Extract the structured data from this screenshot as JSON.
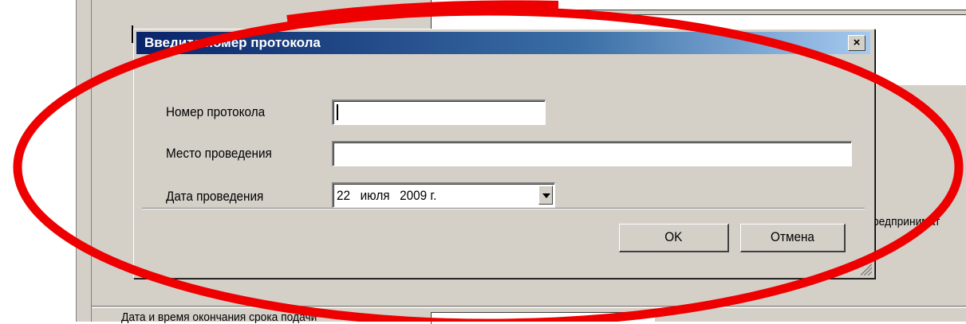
{
  "background": {
    "bottom_label": "Дата и время окончания срока подачи",
    "side_text": "редпринимат"
  },
  "dialog": {
    "title": "Введите номер протокола",
    "close_label": "×",
    "fields": {
      "protocol_number_label": "Номер протокола",
      "protocol_number_value": "",
      "venue_label": "Место проведения",
      "venue_value": "",
      "date_label": "Дата проведения",
      "date_day": "22",
      "date_month": "июля",
      "date_year": "2009 г."
    },
    "buttons": {
      "ok": "OK",
      "cancel": "Отмена"
    }
  },
  "annotation": {
    "color": "#ee0000",
    "shape": "ellipse"
  }
}
